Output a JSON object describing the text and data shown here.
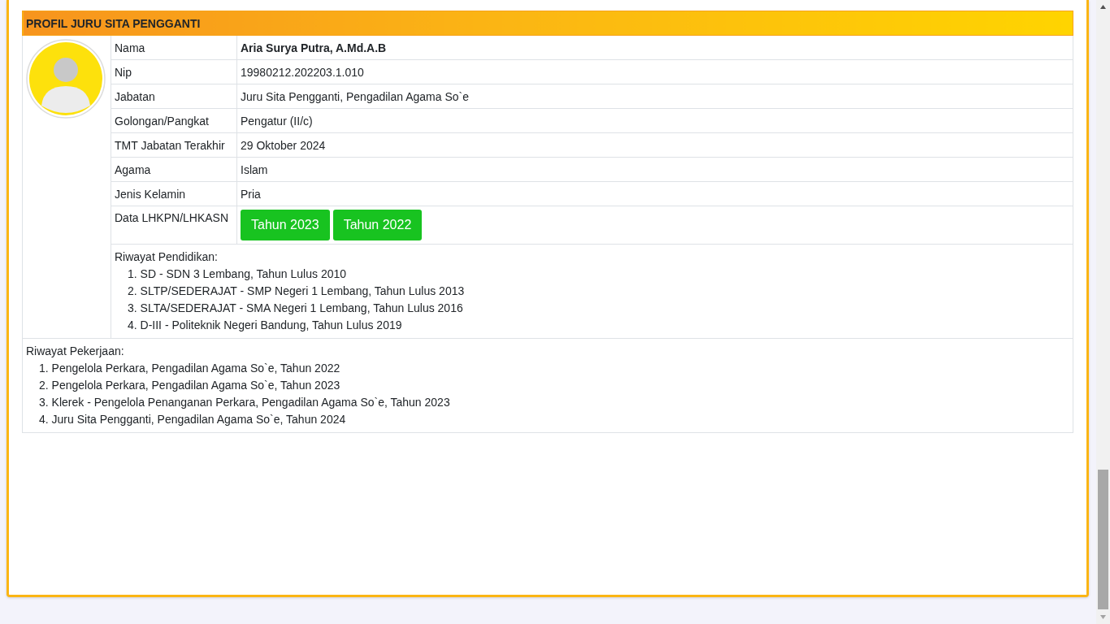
{
  "panel": {
    "title": "PROFIL JURU SITA PENGGANTI"
  },
  "fields": [
    {
      "kind": "name",
      "label": "Nama",
      "value": "Aria Surya Putra, A.Md.A.B"
    },
    {
      "kind": "text",
      "label": "Nip",
      "value": "19980212.202203.1.010"
    },
    {
      "kind": "text",
      "label": "Jabatan",
      "value": "Juru Sita Pengganti, Pengadilan Agama So`e"
    },
    {
      "kind": "text",
      "label": "Golongan/Pangkat",
      "value": "Pengatur (II/c)"
    },
    {
      "kind": "text",
      "label": "TMT Jabatan Terakhir",
      "value": "29 Oktober 2024"
    },
    {
      "kind": "text",
      "label": "Agama",
      "value": "Islam"
    },
    {
      "kind": "text",
      "label": "Jenis Kelamin",
      "value": "Pria"
    },
    {
      "kind": "buttons",
      "label": "Data LHKPN/LHKASN",
      "buttons": [
        "Tahun 2023",
        "Tahun 2022"
      ]
    }
  ],
  "education": {
    "heading": "Riwayat Pendidikan:",
    "items": [
      "1. SD - SDN 3 Lembang, Tahun Lulus 2010",
      "2. SLTP/SEDERAJAT - SMP Negeri 1 Lembang, Tahun Lulus 2013",
      "3. SLTA/SEDERAJAT - SMA Negeri 1 Lembang, Tahun Lulus 2016",
      "4. D-III - Politeknik Negeri Bandung, Tahun Lulus 2019"
    ]
  },
  "work": {
    "heading": "Riwayat Pekerjaan:",
    "items": [
      "1. Pengelola Perkara, Pengadilan Agama So`e, Tahun 2022",
      "2. Pengelola Perkara, Pengadilan Agama So`e, Tahun 2023",
      "3. Klerek - Pengelola Penanganan Perkara, Pengadilan Agama So`e, Tahun 2023",
      "4. Juru Sita Pengganti, Pengadilan Agama So`e, Tahun 2024"
    ]
  }
}
